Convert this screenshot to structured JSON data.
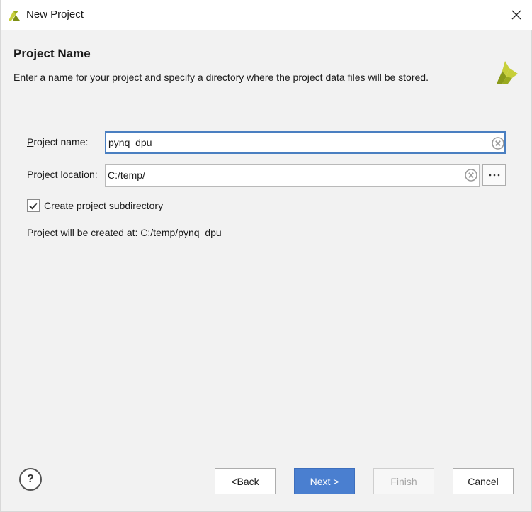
{
  "window": {
    "title": "New Project"
  },
  "header": {
    "section_title": "Project Name",
    "description": "Enter a name for your project and specify a directory where the project data files will be stored."
  },
  "form": {
    "project_name": {
      "label_accel": "P",
      "label_rest": "roject name:",
      "value": "pynq_dpu"
    },
    "project_location": {
      "label_pre": "Project ",
      "label_accel": "l",
      "label_rest": "ocation:",
      "value": "C:/temp/"
    },
    "create_subdirectory": {
      "label": "Create project subdirectory",
      "checked": true
    },
    "result_text": "Project will be created at: C:/temp/pynq_dpu"
  },
  "footer": {
    "help_label": "?",
    "back": {
      "pre": "< ",
      "accel": "B",
      "rest": "ack"
    },
    "next": {
      "accel": "N",
      "rest": "ext >"
    },
    "finish": {
      "accel": "F",
      "rest": "inish"
    },
    "cancel": "Cancel"
  },
  "colors": {
    "accent": "#4a7fd0",
    "focus_border": "#4a7fc1",
    "logo_light": "#c7cf3a",
    "logo_dark": "#8a9a1a"
  }
}
